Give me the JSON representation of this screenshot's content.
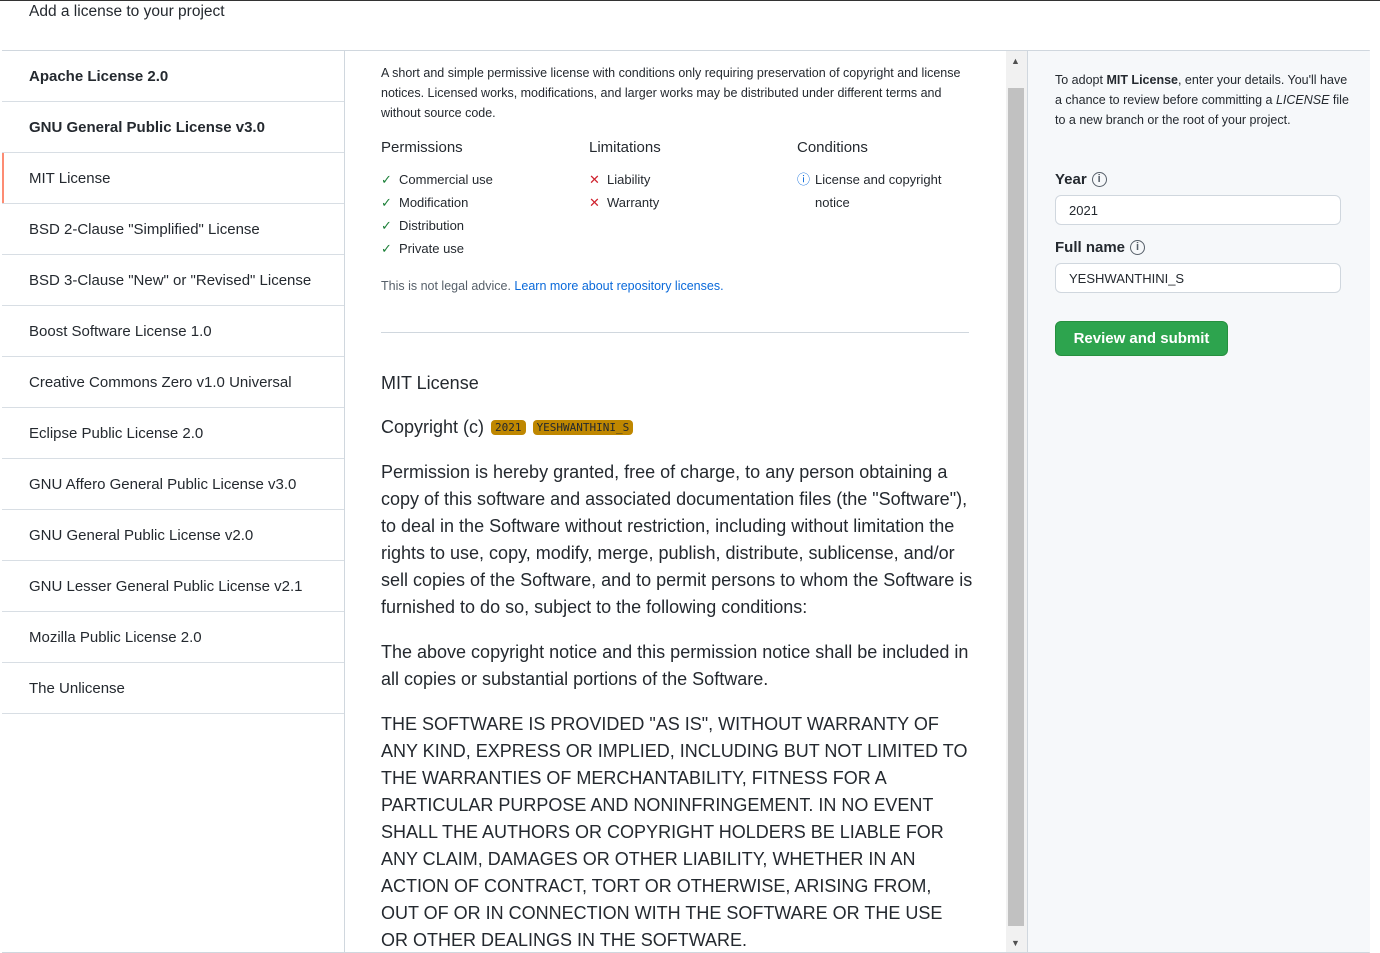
{
  "header": {
    "title": "Add a license to your project"
  },
  "sidebar": {
    "items": [
      {
        "label": "Apache License 2.0"
      },
      {
        "label": "GNU General Public License v3.0"
      },
      {
        "label": "MIT License"
      },
      {
        "label": "BSD 2-Clause \"Simplified\" License"
      },
      {
        "label": "BSD 3-Clause \"New\" or \"Revised\" License"
      },
      {
        "label": "Boost Software License 1.0"
      },
      {
        "label": "Creative Commons Zero v1.0 Universal"
      },
      {
        "label": "Eclipse Public License 2.0"
      },
      {
        "label": "GNU Affero General Public License v3.0"
      },
      {
        "label": "GNU General Public License v2.0"
      },
      {
        "label": "GNU Lesser General Public License v2.1"
      },
      {
        "label": "Mozilla Public License 2.0"
      },
      {
        "label": "The Unlicense"
      }
    ],
    "selected": "MIT License"
  },
  "main": {
    "description": "A short and simple permissive license with conditions only requiring preservation of copyright and license notices. Licensed works, modifications, and larger works may be distributed under different terms and without source code.",
    "permissions": {
      "title": "Permissions",
      "items": [
        "Commercial use",
        "Modification",
        "Distribution",
        "Private use"
      ],
      "icon": "check-icon"
    },
    "limitations": {
      "title": "Limitations",
      "items": [
        "Liability",
        "Warranty"
      ],
      "icon": "x-icon"
    },
    "conditions": {
      "title": "Conditions",
      "items": [
        "License and copyright notice"
      ],
      "icon": "info-icon"
    },
    "legal_text": "This is not legal advice.",
    "legal_link": "Learn more about repository licenses.",
    "license_title": "MIT License",
    "copyright_prefix": "Copyright (c)",
    "copyright_year": "2021",
    "copyright_name": "YESHWANTHINI_S",
    "paragraph1": "Permission is hereby granted, free of charge, to any person obtaining a copy of this software and associated documentation files (the \"Software\"), to deal in the Software without restriction, including without limitation the rights to use, copy, modify, merge, publish, distribute, sublicense, and/or sell copies of the Software, and to permit persons to whom the Software is furnished to do so, subject to the following conditions:",
    "paragraph2": "The above copyright notice and this permission notice shall be included in all copies or substantial portions of the Software.",
    "paragraph3": "THE SOFTWARE IS PROVIDED \"AS IS\", WITHOUT WARRANTY OF ANY KIND, EXPRESS OR IMPLIED, INCLUDING BUT NOT LIMITED TO THE WARRANTIES OF MERCHANTABILITY, FITNESS FOR A PARTICULAR PURPOSE AND NONINFRINGEMENT. IN NO EVENT SHALL THE AUTHORS OR COPYRIGHT HOLDERS BE LIABLE FOR ANY CLAIM, DAMAGES OR OTHER LIABILITY, WHETHER IN AN ACTION OF CONTRACT, TORT OR OTHERWISE, ARISING FROM, OUT OF OR IN CONNECTION WITH THE SOFTWARE OR THE USE OR OTHER DEALINGS IN THE SOFTWARE."
  },
  "panel": {
    "adopt_prefix": "To adopt ",
    "adopt_license": "MIT License",
    "adopt_middle": ", enter your details. You'll have a chance to review before committing a ",
    "adopt_file": "LICENSE",
    "adopt_suffix": " file to a new branch or the root of your project.",
    "year_label": "Year",
    "year_value": "2021",
    "name_label": "Full name",
    "name_value": "YESHWANTHINI_S",
    "submit_label": "Review and submit"
  },
  "colors": {
    "accent": "#2da44e",
    "selected_marker": "#fd8c73",
    "tag_bg": "#bf8700",
    "link": "#0969da"
  }
}
